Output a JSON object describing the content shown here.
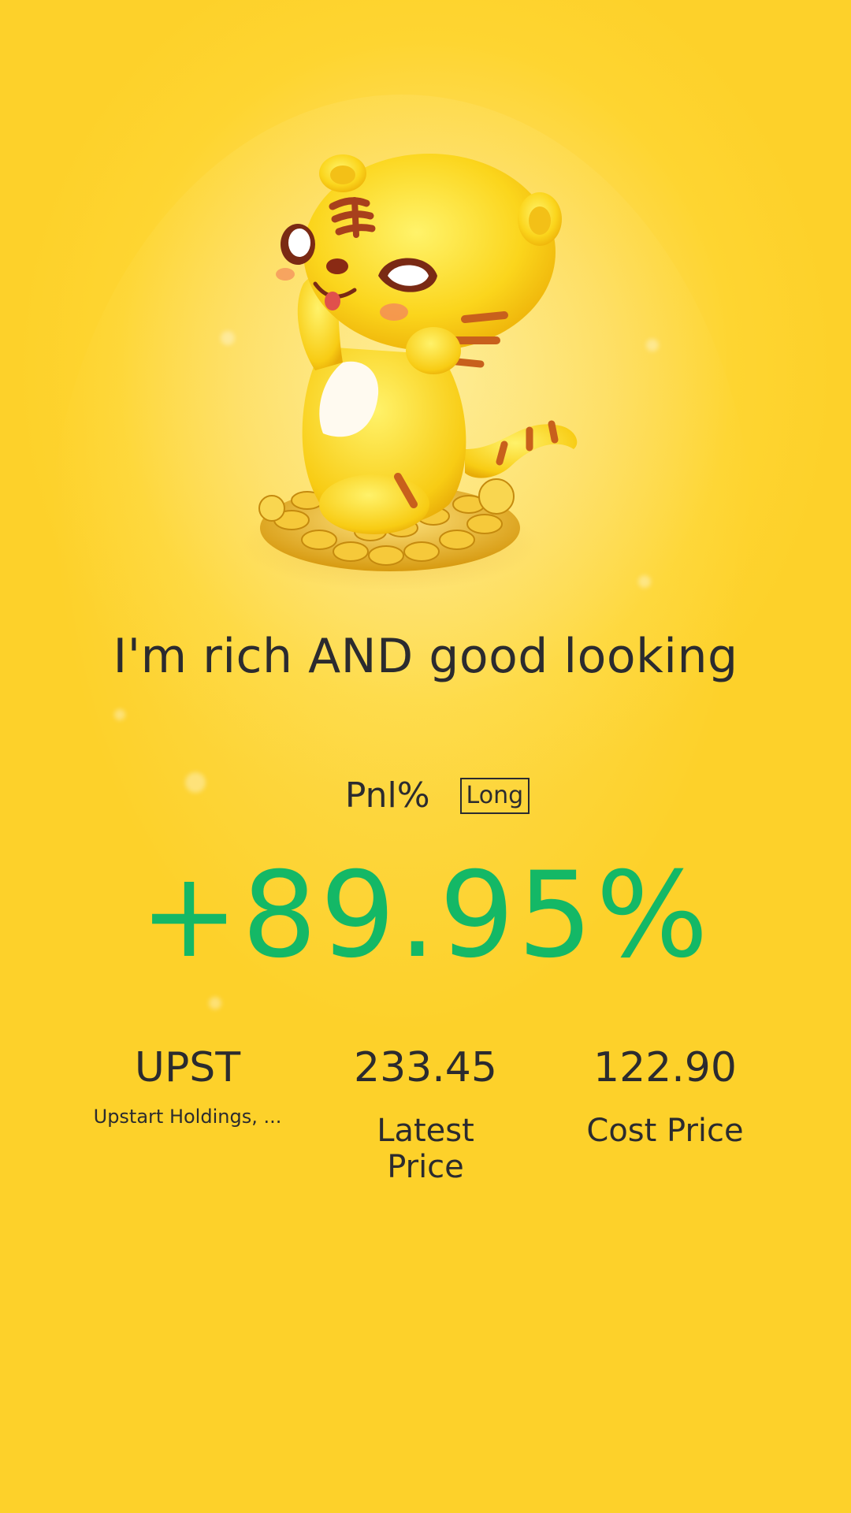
{
  "headline": "I'm rich AND good looking",
  "pnl": {
    "label": "Pnl%",
    "direction_badge": "Long",
    "value": "+89.95%",
    "value_color": "#14b866"
  },
  "stock": {
    "ticker": "UPST",
    "name": "Upstart Holdings, ...",
    "latest_price": "233.45",
    "latest_price_label": "Latest Price",
    "cost_price": "122.90",
    "cost_price_label": "Cost Price"
  },
  "mascot": {
    "icon": "tiger-mascot-on-coins-icon"
  },
  "colors": {
    "background": "#fed531",
    "text": "#2b2b2f",
    "gain": "#14b866"
  }
}
